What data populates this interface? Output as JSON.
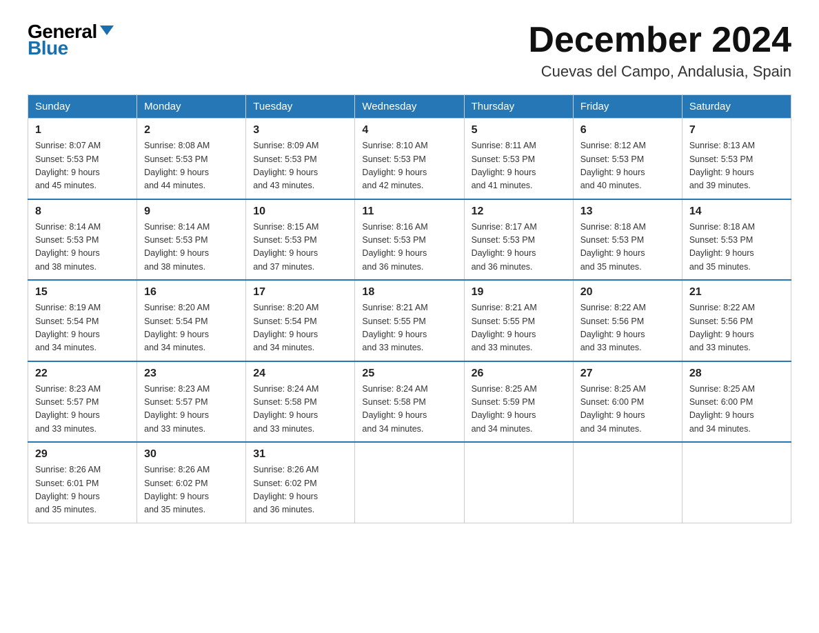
{
  "header": {
    "logo_general": "General",
    "logo_blue": "Blue",
    "month_title": "December 2024",
    "location": "Cuevas del Campo, Andalusia, Spain"
  },
  "days_of_week": [
    "Sunday",
    "Monday",
    "Tuesday",
    "Wednesday",
    "Thursday",
    "Friday",
    "Saturday"
  ],
  "weeks": [
    [
      {
        "day": "1",
        "sunrise": "8:07 AM",
        "sunset": "5:53 PM",
        "daylight": "9 hours and 45 minutes."
      },
      {
        "day": "2",
        "sunrise": "8:08 AM",
        "sunset": "5:53 PM",
        "daylight": "9 hours and 44 minutes."
      },
      {
        "day": "3",
        "sunrise": "8:09 AM",
        "sunset": "5:53 PM",
        "daylight": "9 hours and 43 minutes."
      },
      {
        "day": "4",
        "sunrise": "8:10 AM",
        "sunset": "5:53 PM",
        "daylight": "9 hours and 42 minutes."
      },
      {
        "day": "5",
        "sunrise": "8:11 AM",
        "sunset": "5:53 PM",
        "daylight": "9 hours and 41 minutes."
      },
      {
        "day": "6",
        "sunrise": "8:12 AM",
        "sunset": "5:53 PM",
        "daylight": "9 hours and 40 minutes."
      },
      {
        "day": "7",
        "sunrise": "8:13 AM",
        "sunset": "5:53 PM",
        "daylight": "9 hours and 39 minutes."
      }
    ],
    [
      {
        "day": "8",
        "sunrise": "8:14 AM",
        "sunset": "5:53 PM",
        "daylight": "9 hours and 38 minutes."
      },
      {
        "day": "9",
        "sunrise": "8:14 AM",
        "sunset": "5:53 PM",
        "daylight": "9 hours and 38 minutes."
      },
      {
        "day": "10",
        "sunrise": "8:15 AM",
        "sunset": "5:53 PM",
        "daylight": "9 hours and 37 minutes."
      },
      {
        "day": "11",
        "sunrise": "8:16 AM",
        "sunset": "5:53 PM",
        "daylight": "9 hours and 36 minutes."
      },
      {
        "day": "12",
        "sunrise": "8:17 AM",
        "sunset": "5:53 PM",
        "daylight": "9 hours and 36 minutes."
      },
      {
        "day": "13",
        "sunrise": "8:18 AM",
        "sunset": "5:53 PM",
        "daylight": "9 hours and 35 minutes."
      },
      {
        "day": "14",
        "sunrise": "8:18 AM",
        "sunset": "5:53 PM",
        "daylight": "9 hours and 35 minutes."
      }
    ],
    [
      {
        "day": "15",
        "sunrise": "8:19 AM",
        "sunset": "5:54 PM",
        "daylight": "9 hours and 34 minutes."
      },
      {
        "day": "16",
        "sunrise": "8:20 AM",
        "sunset": "5:54 PM",
        "daylight": "9 hours and 34 minutes."
      },
      {
        "day": "17",
        "sunrise": "8:20 AM",
        "sunset": "5:54 PM",
        "daylight": "9 hours and 34 minutes."
      },
      {
        "day": "18",
        "sunrise": "8:21 AM",
        "sunset": "5:55 PM",
        "daylight": "9 hours and 33 minutes."
      },
      {
        "day": "19",
        "sunrise": "8:21 AM",
        "sunset": "5:55 PM",
        "daylight": "9 hours and 33 minutes."
      },
      {
        "day": "20",
        "sunrise": "8:22 AM",
        "sunset": "5:56 PM",
        "daylight": "9 hours and 33 minutes."
      },
      {
        "day": "21",
        "sunrise": "8:22 AM",
        "sunset": "5:56 PM",
        "daylight": "9 hours and 33 minutes."
      }
    ],
    [
      {
        "day": "22",
        "sunrise": "8:23 AM",
        "sunset": "5:57 PM",
        "daylight": "9 hours and 33 minutes."
      },
      {
        "day": "23",
        "sunrise": "8:23 AM",
        "sunset": "5:57 PM",
        "daylight": "9 hours and 33 minutes."
      },
      {
        "day": "24",
        "sunrise": "8:24 AM",
        "sunset": "5:58 PM",
        "daylight": "9 hours and 33 minutes."
      },
      {
        "day": "25",
        "sunrise": "8:24 AM",
        "sunset": "5:58 PM",
        "daylight": "9 hours and 34 minutes."
      },
      {
        "day": "26",
        "sunrise": "8:25 AM",
        "sunset": "5:59 PM",
        "daylight": "9 hours and 34 minutes."
      },
      {
        "day": "27",
        "sunrise": "8:25 AM",
        "sunset": "6:00 PM",
        "daylight": "9 hours and 34 minutes."
      },
      {
        "day": "28",
        "sunrise": "8:25 AM",
        "sunset": "6:00 PM",
        "daylight": "9 hours and 34 minutes."
      }
    ],
    [
      {
        "day": "29",
        "sunrise": "8:26 AM",
        "sunset": "6:01 PM",
        "daylight": "9 hours and 35 minutes."
      },
      {
        "day": "30",
        "sunrise": "8:26 AM",
        "sunset": "6:02 PM",
        "daylight": "9 hours and 35 minutes."
      },
      {
        "day": "31",
        "sunrise": "8:26 AM",
        "sunset": "6:02 PM",
        "daylight": "9 hours and 36 minutes."
      },
      null,
      null,
      null,
      null
    ]
  ]
}
